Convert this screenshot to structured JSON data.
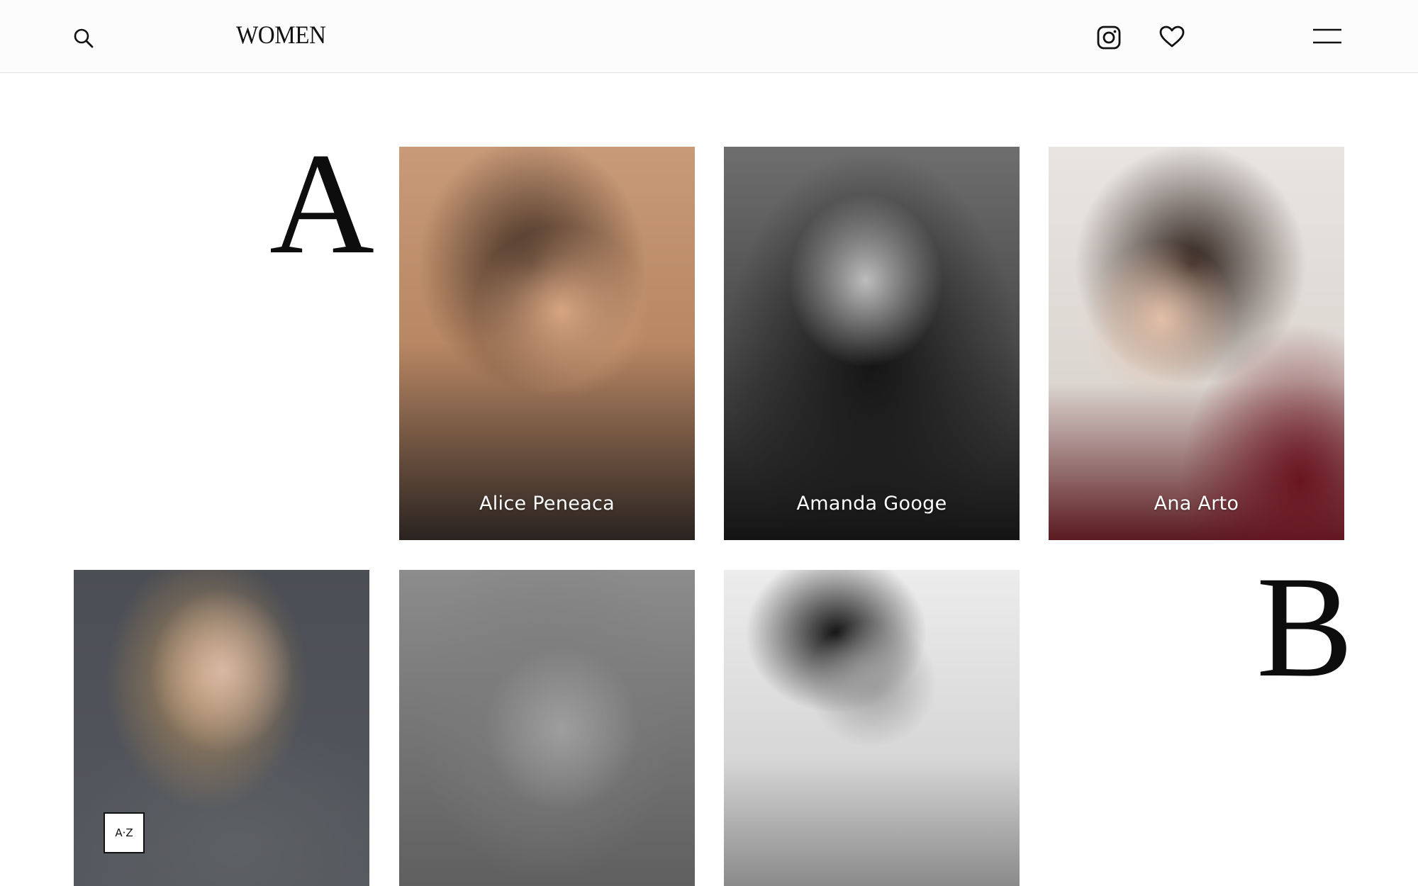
{
  "header": {
    "brand": "WOMEN",
    "icons": [
      "search-icon",
      "instagram-icon",
      "heart-icon",
      "menu-icon"
    ]
  },
  "sections": [
    {
      "letter": "A",
      "models": [
        {
          "name": "Alice Peneaca"
        },
        {
          "name": "Amanda Googe"
        },
        {
          "name": "Ana Arto"
        }
      ]
    },
    {
      "letter": "B"
    }
  ],
  "az_badge": {
    "label": "A·Z"
  },
  "colors": {
    "header_bg": "#fcfcfc",
    "page_bg": "#ffffff",
    "text": "#111111"
  }
}
